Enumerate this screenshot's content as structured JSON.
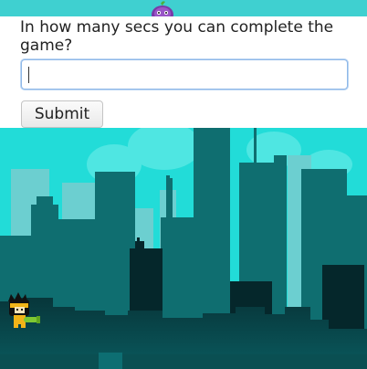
{
  "form": {
    "question": "In how many secs you can complete the game?",
    "answer_value": "",
    "submit_label": "Submit"
  },
  "colors": {
    "sky": "#22dcd8",
    "buildings_back": "#6ccfd0",
    "buildings_mid": "#0f6e70",
    "buildings_front": "#05272b",
    "ground_gradient_bottom": "#0a4f52",
    "character_headband": "#f2b418",
    "character_gun": "#7ec832"
  },
  "icons": {
    "mascot": "purple-onion-mascot-icon",
    "player": "ninja-character-icon"
  }
}
